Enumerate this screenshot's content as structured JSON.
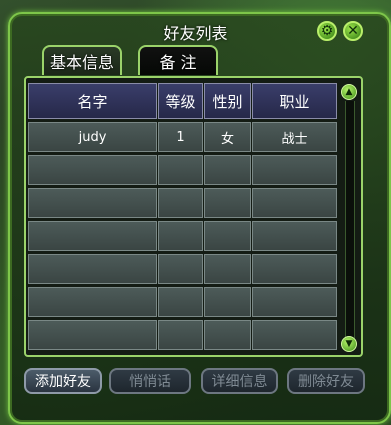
{
  "window": {
    "title": "好友列表"
  },
  "tabs": [
    {
      "label": "基本信息",
      "active": true
    },
    {
      "label": "备 注",
      "active": false
    }
  ],
  "table": {
    "columns": [
      "名字",
      "等级",
      "性别",
      "职业"
    ],
    "rows": [
      [
        "judy",
        "1",
        "女",
        "战士"
      ],
      [
        "",
        "",
        "",
        ""
      ],
      [
        "",
        "",
        "",
        ""
      ],
      [
        "",
        "",
        "",
        ""
      ],
      [
        "",
        "",
        "",
        ""
      ],
      [
        "",
        "",
        "",
        ""
      ],
      [
        "",
        "",
        "",
        ""
      ]
    ]
  },
  "actions": [
    {
      "label": "添加好友",
      "enabled": true
    },
    {
      "label": "悄悄话",
      "enabled": false
    },
    {
      "label": "详细信息",
      "enabled": false
    },
    {
      "label": "删除好友",
      "enabled": false
    }
  ],
  "icons": {
    "settings": "gear-icon",
    "close": "close-icon"
  },
  "colors": {
    "frame": "#7ec64a",
    "header": "#2f3258",
    "cell": "#465351"
  }
}
